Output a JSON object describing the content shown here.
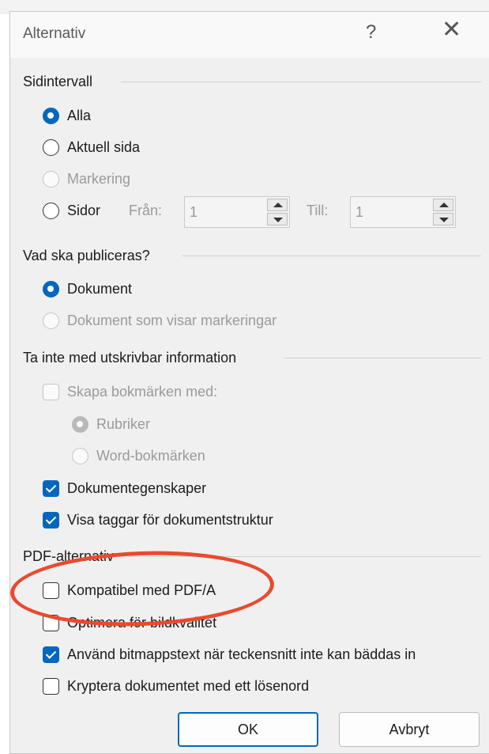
{
  "dialog": {
    "title": "Alternativ",
    "help_glyph": "?",
    "close_glyph": "✕"
  },
  "page_range": {
    "group_label": "Sidintervall",
    "options": [
      {
        "label": "Alla",
        "state": "checked"
      },
      {
        "label": "Aktuell sida",
        "state": "unchecked"
      },
      {
        "label": "Markering",
        "state": "disabled"
      },
      {
        "label": "Sidor",
        "state": "unchecked"
      }
    ],
    "from_label": "Från:",
    "from_value": "1",
    "to_label": "Till:",
    "to_value": "1"
  },
  "publish": {
    "group_label": "Vad ska publiceras?",
    "options": [
      {
        "label": "Dokument",
        "state": "checked"
      },
      {
        "label": "Dokument som visar markeringar",
        "state": "disabled"
      }
    ]
  },
  "non_printing": {
    "group_label": "Ta inte med utskrivbar information",
    "create_bookmarks": {
      "label": "Skapa bokmärken med:",
      "checked": false,
      "disabled": true
    },
    "bookmark_options": [
      {
        "label": "Rubriker",
        "state": "disabled-checked"
      },
      {
        "label": "Word-bokmärken",
        "state": "disabled"
      }
    ],
    "document_properties": {
      "label": "Dokumentegenskaper",
      "checked": true
    },
    "structure_tags": {
      "label": "Visa taggar för dokumentstruktur",
      "checked": true
    }
  },
  "pdf_options": {
    "group_label": "PDF-alternativ",
    "items": [
      {
        "label": "Kompatibel med PDF/A",
        "checked": false
      },
      {
        "label": "Optimera för bildkvalitet",
        "checked": false
      },
      {
        "label": "Använd bitmappstext när teckensnitt inte kan bäddas in",
        "checked": true
      },
      {
        "label": "Kryptera dokumentet med ett lösenord",
        "checked": false
      }
    ]
  },
  "buttons": {
    "ok": "OK",
    "cancel": "Avbryt"
  },
  "colors": {
    "accent": "#0067c0",
    "annotation": "#e94a2e"
  }
}
